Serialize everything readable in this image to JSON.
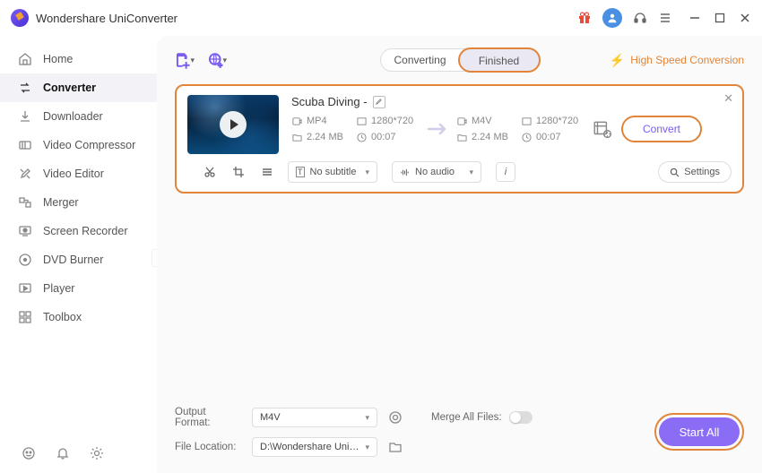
{
  "app": {
    "title": "Wondershare UniConverter"
  },
  "sidebar": {
    "items": [
      {
        "label": "Home",
        "icon": "home-icon"
      },
      {
        "label": "Converter",
        "icon": "converter-icon"
      },
      {
        "label": "Downloader",
        "icon": "downloader-icon"
      },
      {
        "label": "Video Compressor",
        "icon": "compressor-icon"
      },
      {
        "label": "Video Editor",
        "icon": "editor-icon"
      },
      {
        "label": "Merger",
        "icon": "merger-icon"
      },
      {
        "label": "Screen Recorder",
        "icon": "recorder-icon"
      },
      {
        "label": "DVD Burner",
        "icon": "burner-icon"
      },
      {
        "label": "Player",
        "icon": "player-icon"
      },
      {
        "label": "Toolbox",
        "icon": "toolbox-icon"
      }
    ]
  },
  "tabs": {
    "converting": "Converting",
    "finished": "Finished"
  },
  "hs": {
    "label": "High Speed Conversion"
  },
  "file": {
    "name": "Scuba Diving  -",
    "src": {
      "format": "MP4",
      "resolution": "1280*720",
      "size": "2.24 MB",
      "duration": "00:07"
    },
    "dst": {
      "format": "M4V",
      "resolution": "1280*720",
      "size": "2.24 MB",
      "duration": "00:07"
    },
    "convert_label": "Convert",
    "subtitle": {
      "label": "No subtitle"
    },
    "audio": {
      "label": "No audio"
    },
    "settings_label": "Settings"
  },
  "footer": {
    "output_format_label": "Output Format:",
    "output_format_value": "M4V",
    "file_location_label": "File Location:",
    "file_location_value": "D:\\Wondershare UniConverter",
    "merge_label": "Merge All Files:",
    "start_all": "Start All"
  }
}
